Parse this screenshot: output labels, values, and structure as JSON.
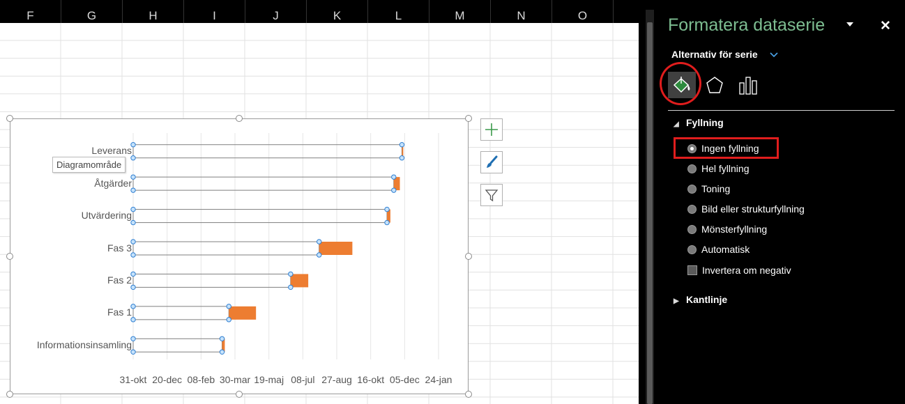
{
  "sheet": {
    "columns": [
      "F",
      "G",
      "H",
      "I",
      "J",
      "K",
      "L",
      "M",
      "N",
      "O"
    ]
  },
  "chart": {
    "tooltip": "Diagramområde",
    "bar_color": "#ED7D31"
  },
  "chart_data": {
    "type": "bar",
    "orientation": "horizontal-stacked",
    "categories": [
      "Leverans",
      "Åtgärder",
      "Utvärdering",
      "Fas 3",
      "Fas 2",
      "Fas 1",
      "Informationsinsamling"
    ],
    "x_tick_labels": [
      "31-okt",
      "20-dec",
      "08-feb",
      "30-mar",
      "19-maj",
      "08-jul",
      "27-aug",
      "16-okt",
      "05-dec",
      "24-jan"
    ],
    "xlim": [
      "2016-10-31",
      "2018-01-24"
    ],
    "series": [
      {
        "start": [
          "2017-12-01",
          "2017-11-19",
          "2017-11-09",
          "2017-08-01",
          "2017-06-20",
          "2017-03-21",
          "2017-03-11"
        ]
      },
      {
        "duration_days": [
          2,
          9,
          5,
          49,
          26,
          40,
          4
        ]
      }
    ],
    "grid": true
  },
  "panel": {
    "title": "Formatera dataserie",
    "series_options": "Alternativ för serie",
    "fill_section": "Fyllning",
    "fill_options": [
      {
        "label": "Ingen fyllning",
        "selected": true
      },
      {
        "label": "Hel fyllning",
        "selected": false
      },
      {
        "label": "Toning",
        "selected": false
      },
      {
        "label": "Bild eller strukturfyllning",
        "selected": false
      },
      {
        "label": "Mönsterfyllning",
        "selected": false
      },
      {
        "label": "Automatisk",
        "selected": false
      }
    ],
    "invert_label": "Invertera om negativ",
    "border_section": "Kantlinje",
    "highlight_color": "#E01D1D",
    "title_color": "#7DBD91"
  }
}
